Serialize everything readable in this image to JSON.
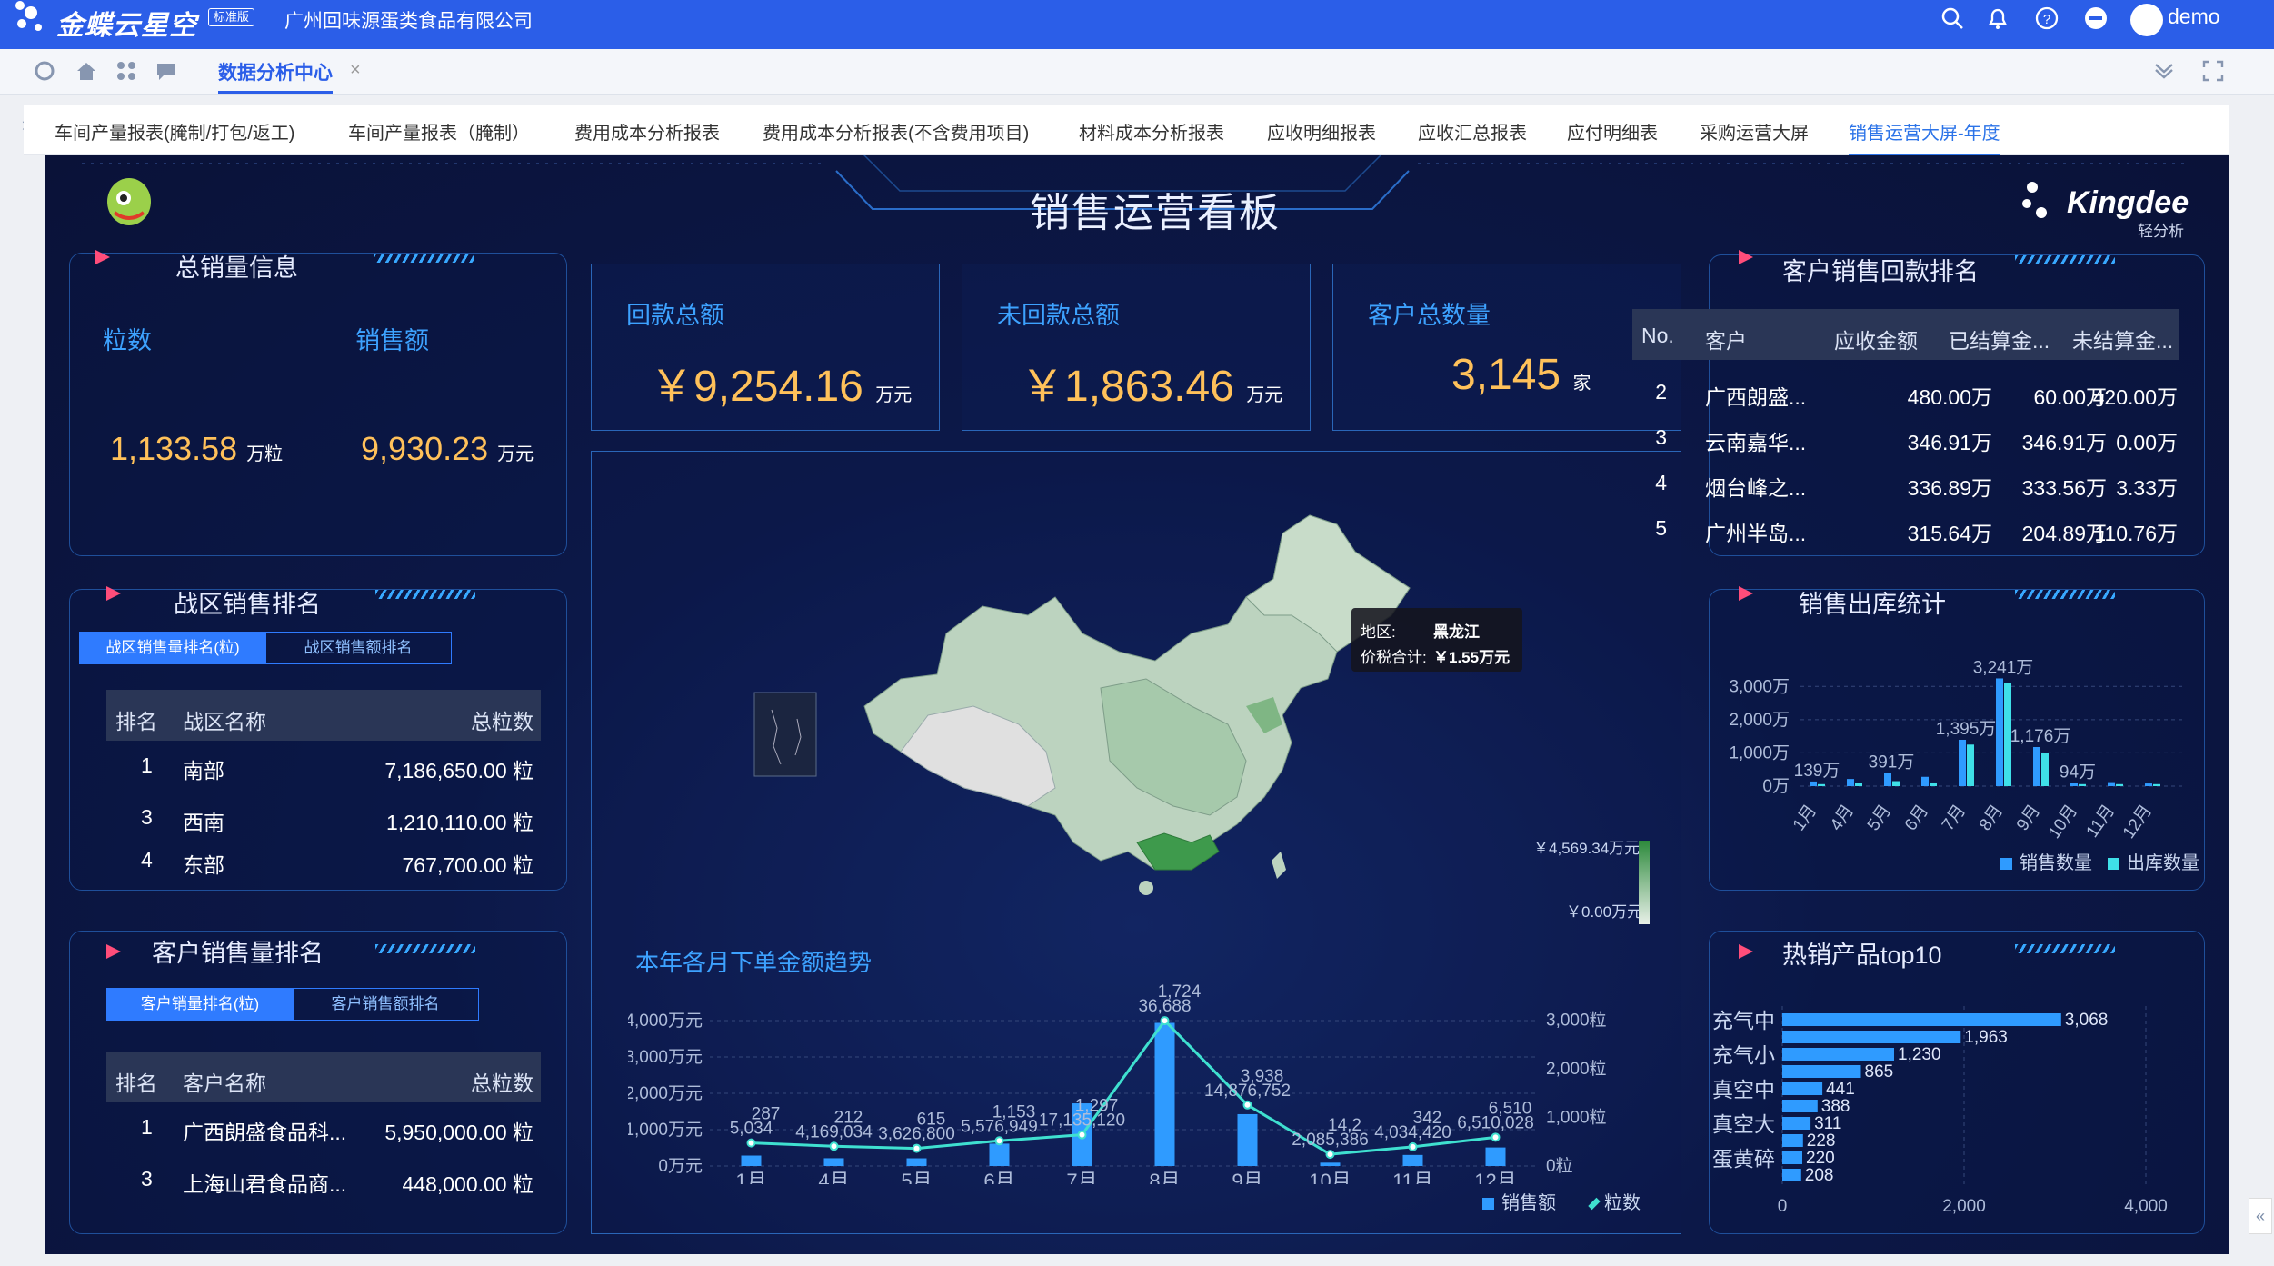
{
  "app": {
    "brand": "金蝶云星空",
    "edition": "标准版",
    "company": "广州回味源蛋类食品有限公司",
    "user": "demo"
  },
  "tabbar": {
    "active_tab": "数据分析中心",
    "close": "×"
  },
  "subtabs": [
    "车间产量报表(腌制/打包/返工)",
    "车间产量报表（腌制）",
    "费用成本分析报表",
    "费用成本分析报表(不含费用项目)",
    "材料成本分析报表",
    "应收明细报表",
    "应收汇总报表",
    "应付明细表",
    "采购运营大屏",
    "销售运营大屏-年度"
  ],
  "dashboard": {
    "title": "销售运营看板",
    "kingdee_logo": "Kingdee",
    "kingdee_sub": "轻分析"
  },
  "total_sales": {
    "title": "总销量信息",
    "qty_label": "粒数",
    "amount_label": "销售额",
    "qty_value": "1,133.58",
    "qty_unit": "万粒",
    "amount_value": "9,930.23",
    "amount_unit": "万元"
  },
  "kpis": [
    {
      "label": "回款总额",
      "value": "￥9,254.16",
      "unit": "万元"
    },
    {
      "label": "未回款总额",
      "value": "￥1,863.46",
      "unit": "万元"
    },
    {
      "label": "客户总数量",
      "value": "3,145",
      "unit": "家"
    }
  ],
  "zone_rank": {
    "title": "战区销售排名",
    "seg_on": "战区销售量排名(粒)",
    "seg_off": "战区销售额排名",
    "headers": [
      "排名",
      "战区名称",
      "总粒数"
    ],
    "rows": [
      [
        "1",
        "南部",
        "7,186,650.00 粒"
      ],
      [
        "3",
        "西南",
        "1,210,110.00 粒"
      ],
      [
        "4",
        "东部",
        "767,700.00 粒"
      ]
    ]
  },
  "cust_rank": {
    "title": "客户销售量排名",
    "seg_on": "客户销量排名(粒)",
    "seg_off": "客户销售额排名",
    "headers": [
      "排名",
      "客户名称",
      "总粒数"
    ],
    "rows": [
      [
        "1",
        "广西朗盛食品科...",
        "5,950,000.00 粒"
      ],
      [
        "3",
        "上海山君食品商...",
        "448,000.00 粒"
      ]
    ]
  },
  "cust_pay": {
    "title": "客户销售回款排名",
    "headers": [
      "No.",
      "客户",
      "应收金额",
      "已结算金...",
      "未结算金..."
    ],
    "rows": [
      [
        "2",
        "广西朗盛...",
        "480.00万",
        "60.00万",
        "420.00万"
      ],
      [
        "3",
        "云南嘉华...",
        "346.91万",
        "346.91万",
        "0.00万"
      ],
      [
        "4",
        "烟台峰之...",
        "336.89万",
        "333.56万",
        "3.33万"
      ],
      [
        "5",
        "广州半岛...",
        "315.64万",
        "204.89万",
        "110.76万"
      ]
    ]
  },
  "map": {
    "tooltip_region_label": "地区:",
    "tooltip_region": "黑龙江",
    "tooltip_value_label": "价税合计:",
    "tooltip_value": "￥1.55万元",
    "scale_max": "￥4,569.34万元",
    "scale_min": "￥0.00万元"
  },
  "colors": {
    "accent": "#3da2ff",
    "bar": "#2f9bff",
    "line": "#3fe0d0",
    "orange": "#ffc15a",
    "arrow": "#ff4d7a"
  },
  "chart_data": [
    {
      "type": "bar",
      "title": "销售出库统计",
      "categories": [
        "1月",
        "4月",
        "5月",
        "6月",
        "7月",
        "8月",
        "9月",
        "10月",
        "11月",
        "12月"
      ],
      "series": [
        {
          "name": "销售数量",
          "values": [
            139,
            215,
            391,
            280,
            1395,
            3241,
            1176,
            94,
            120,
            80
          ]
        },
        {
          "name": "出库数量",
          "values": [
            60,
            90,
            150,
            110,
            1250,
            3100,
            1000,
            60,
            60,
            60
          ]
        }
      ],
      "data_labels": [
        "139万",
        "391万",
        "1,395万",
        "3,241万",
        "1,176万",
        "94万"
      ],
      "yticks": [
        "3,000万",
        "2,000万",
        "1,000万",
        "0万"
      ],
      "ylim": [
        0,
        3500
      ]
    },
    {
      "type": "bar",
      "title": "热销产品top10",
      "orientation": "horizontal",
      "categories": [
        "充气中",
        "充气小",
        "真空中",
        "真空大",
        "蛋黄碎"
      ],
      "values": [
        3068,
        1963,
        1230,
        865,
        441,
        388,
        311,
        228,
        220,
        208
      ],
      "xticks": [
        "0",
        "2,000",
        "4,000"
      ],
      "xlim": [
        0,
        4400
      ]
    },
    {
      "type": "bar+line",
      "title": "本年各月下单金额趋势",
      "categories": [
        "1月",
        "4月",
        "5月",
        "6月",
        "7月",
        "8月",
        "9月",
        "10月",
        "11月",
        "12月"
      ],
      "series": [
        {
          "name": "销售额",
          "values": [
            287,
            214,
            212,
            615,
            1724,
            3938,
            1426,
            92,
            304,
            510
          ]
        },
        {
          "name": "粒数",
          "values": [
            5034,
            4169,
            3626,
            5577,
            7135,
            36688,
            14876,
            2085,
            4034,
            6510
          ]
        }
      ],
      "bar_labels": [
        "5,034",
        "4,169,034",
        "3,626,800",
        "5,576,949",
        "17,135,120",
        "36,688",
        "14,876,752",
        "2,085,386",
        "4,034,420",
        "6,510,028"
      ],
      "line_labels": [
        "287",
        "212",
        "615",
        "1,153",
        "1,297",
        "1,724",
        "3,938",
        "14,2",
        "342",
        "6,510"
      ],
      "yticks_left": [
        "4,000万元",
        "3,000万元",
        "2,000万元",
        "1,000万元",
        "0万元"
      ],
      "yticks_right": [
        "3,000粒",
        "2,000粒",
        "1,000粒",
        "0粒"
      ],
      "ylim": [
        0,
        4000
      ]
    }
  ]
}
